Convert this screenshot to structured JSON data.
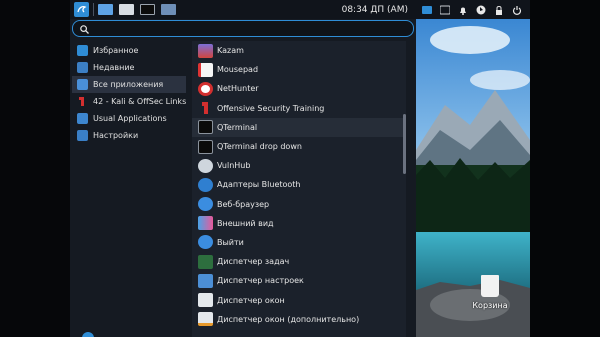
{
  "panel": {
    "clock": "08:34 ДП (AM)"
  },
  "search": {
    "placeholder": "",
    "value": ""
  },
  "categories": [
    {
      "label": "Избранное",
      "icon": "star-icon"
    },
    {
      "label": "Недавние",
      "icon": "recent-icon"
    },
    {
      "label": "Все приложения",
      "icon": "all-apps-icon",
      "active": true
    },
    {
      "label": "42 - Kali & OffSec Links",
      "icon": "kali-links-icon"
    },
    {
      "label": "Usual Applications",
      "icon": "folder-icon"
    },
    {
      "label": "Настройки",
      "icon": "settings-icon"
    }
  ],
  "apps": [
    {
      "label": "Kazam",
      "icon": "kazam-icon"
    },
    {
      "label": "Mousepad",
      "icon": "mousepad-icon"
    },
    {
      "label": "NetHunter",
      "icon": "nethunter-icon"
    },
    {
      "label": "Offensive Security Training",
      "icon": "offsec-icon"
    },
    {
      "label": "QTerminal",
      "icon": "terminal-icon",
      "hover": true
    },
    {
      "label": "QTerminal drop down",
      "icon": "terminal-icon"
    },
    {
      "label": "VulnHub",
      "icon": "vulnhub-icon"
    },
    {
      "label": "Адаптеры Bluetooth",
      "icon": "bluetooth-icon"
    },
    {
      "label": "Веб-браузер",
      "icon": "browser-icon"
    },
    {
      "label": "Внешний вид",
      "icon": "appearance-icon"
    },
    {
      "label": "Выйти",
      "icon": "logout-icon"
    },
    {
      "label": "Диспетчер задач",
      "icon": "task-manager-icon"
    },
    {
      "label": "Диспетчер настроек",
      "icon": "settings-manager-icon"
    },
    {
      "label": "Диспетчер окон",
      "icon": "window-manager-icon"
    },
    {
      "label": "Диспетчер окон (дополнительно)",
      "icon": "window-manager-tweaks-icon"
    }
  ],
  "desktop": {
    "trash_label": "Корзина"
  },
  "colors": {
    "accent": "#2f8dd6",
    "menu_bg": "#151a22",
    "list_bg": "#1b212b"
  }
}
